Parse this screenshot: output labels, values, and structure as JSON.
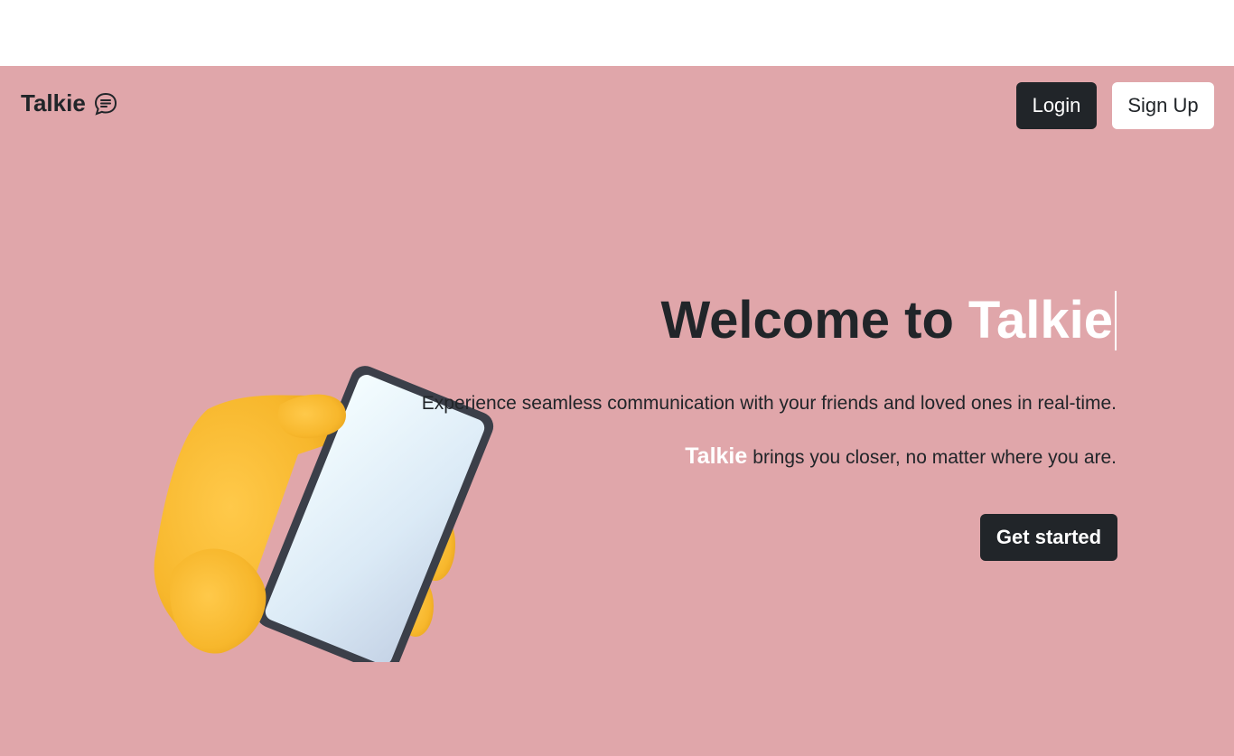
{
  "navbar": {
    "brand": "Talkie",
    "brand_icon": "chat-bubble-icon",
    "login_label": "Login",
    "signup_label": "Sign Up"
  },
  "hero": {
    "title_prefix": "Welcome to",
    "title_brand": "Talkie",
    "description": "Experience seamless communication with your friends and loved ones in real-time.",
    "tagline_brand": "Talkie",
    "tagline_rest": "brings you closer, no matter where you are.",
    "cta_label": "Get started",
    "illustration": "hand-holding-phone-icon"
  },
  "colors": {
    "background": "#e0a6aa",
    "dark": "#212529",
    "accent": "#ffffff"
  }
}
